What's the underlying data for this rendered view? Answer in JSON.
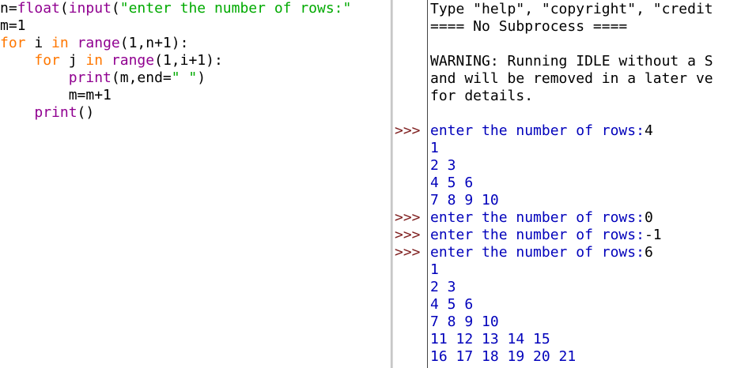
{
  "editor": {
    "lines": [
      [
        {
          "t": "n=",
          "c": "plain"
        },
        {
          "t": "float",
          "c": "bi"
        },
        {
          "t": "(",
          "c": "plain"
        },
        {
          "t": "input",
          "c": "bi"
        },
        {
          "t": "(",
          "c": "plain"
        },
        {
          "t": "\"enter the number of rows:\"",
          "c": "str"
        }
      ],
      [
        {
          "t": "m=1",
          "c": "plain"
        }
      ],
      [
        {
          "t": "for",
          "c": "kw"
        },
        {
          "t": " i ",
          "c": "plain"
        },
        {
          "t": "in",
          "c": "kw"
        },
        {
          "t": " ",
          "c": "plain"
        },
        {
          "t": "range",
          "c": "bi"
        },
        {
          "t": "(1,n+1):",
          "c": "plain"
        }
      ],
      [
        {
          "t": "    ",
          "c": "plain"
        },
        {
          "t": "for",
          "c": "kw"
        },
        {
          "t": " j ",
          "c": "plain"
        },
        {
          "t": "in",
          "c": "kw"
        },
        {
          "t": " ",
          "c": "plain"
        },
        {
          "t": "range",
          "c": "bi"
        },
        {
          "t": "(1,i+1):",
          "c": "plain"
        }
      ],
      [
        {
          "t": "        ",
          "c": "plain"
        },
        {
          "t": "print",
          "c": "bi"
        },
        {
          "t": "(m,end=",
          "c": "plain"
        },
        {
          "t": "\" \"",
          "c": "str"
        },
        {
          "t": ")",
          "c": "plain"
        }
      ],
      [
        {
          "t": "        m=m+1",
          "c": "plain"
        }
      ],
      [
        {
          "t": "    ",
          "c": "plain"
        },
        {
          "t": "print",
          "c": "bi"
        },
        {
          "t": "()",
          "c": "plain"
        }
      ]
    ]
  },
  "shell": {
    "prompt_symbol": ">>>",
    "lines": [
      {
        "text": "Type \"help\", \"copyright\", \"credit",
        "cls": "plain",
        "prompt": false
      },
      {
        "text": "==== No Subprocess ====",
        "cls": "plain",
        "prompt": false
      },
      {
        "text": "",
        "cls": "plain",
        "prompt": false
      },
      {
        "text": "WARNING: Running IDLE without a S",
        "cls": "plain",
        "prompt": false
      },
      {
        "text": "and will be removed in a later ve",
        "cls": "plain",
        "prompt": false
      },
      {
        "text": "for details.",
        "cls": "plain",
        "prompt": false
      },
      {
        "text": "",
        "cls": "plain",
        "prompt": false
      },
      {
        "text": "enter the number of rows:",
        "input": "4",
        "cls": "stdout",
        "prompt": true
      },
      {
        "text": "1",
        "cls": "stdout",
        "prompt": false
      },
      {
        "text": "2 3",
        "cls": "stdout",
        "prompt": false
      },
      {
        "text": "4 5 6",
        "cls": "stdout",
        "prompt": false
      },
      {
        "text": "7 8 9 10",
        "cls": "stdout",
        "prompt": false
      },
      {
        "text": "enter the number of rows:",
        "input": "0",
        "cls": "stdout",
        "prompt": true
      },
      {
        "text": "enter the number of rows:",
        "input": "-1",
        "cls": "stdout",
        "prompt": true
      },
      {
        "text": "enter the number of rows:",
        "input": "6",
        "cls": "stdout",
        "prompt": true
      },
      {
        "text": "1",
        "cls": "stdout",
        "prompt": false
      },
      {
        "text": "2 3",
        "cls": "stdout",
        "prompt": false
      },
      {
        "text": "4 5 6",
        "cls": "stdout",
        "prompt": false
      },
      {
        "text": "7 8 9 10",
        "cls": "stdout",
        "prompt": false
      },
      {
        "text": "11 12 13 14 15",
        "cls": "stdout",
        "prompt": false
      },
      {
        "text": "16 17 18 19 20 21",
        "cls": "stdout",
        "prompt": false
      }
    ]
  }
}
